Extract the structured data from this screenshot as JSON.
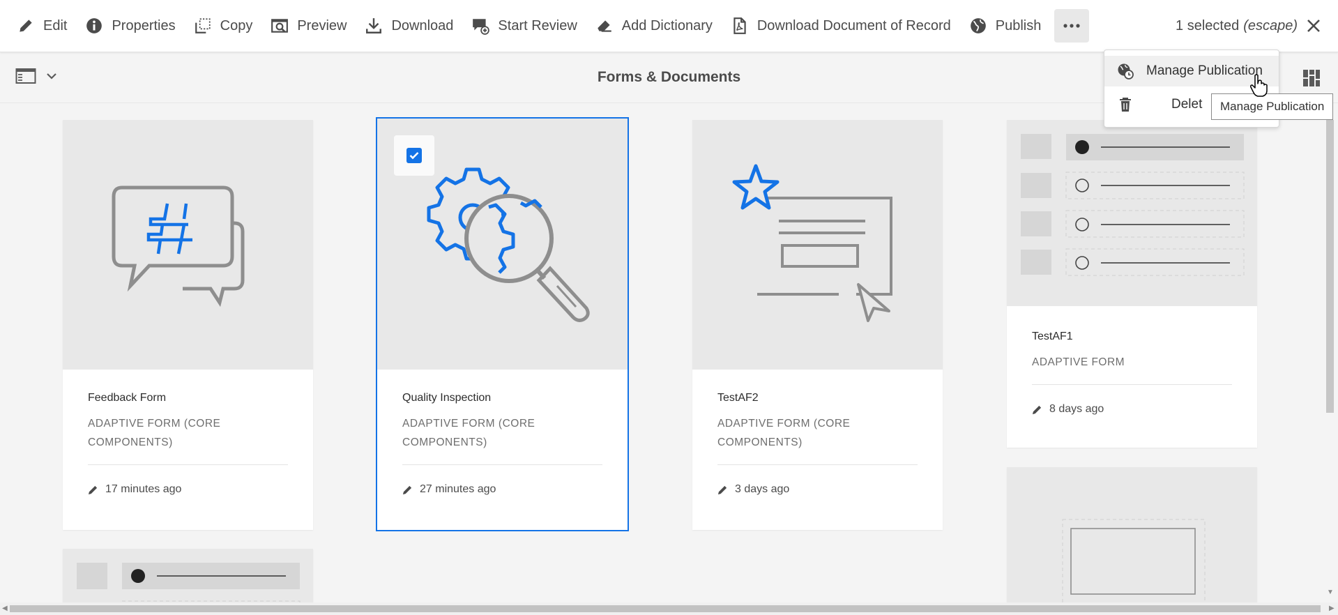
{
  "toolbar": {
    "actions": [
      {
        "label": "Edit",
        "icon": "pencil-icon"
      },
      {
        "label": "Properties",
        "icon": "info-icon"
      },
      {
        "label": "Copy",
        "icon": "copy-icon"
      },
      {
        "label": "Preview",
        "icon": "preview-icon"
      },
      {
        "label": "Download",
        "icon": "download-icon"
      },
      {
        "label": "Start Review",
        "icon": "review-icon"
      },
      {
        "label": "Add Dictionary",
        "icon": "eraser-icon"
      },
      {
        "label": "Download Document of Record",
        "icon": "pdf-icon"
      },
      {
        "label": "Publish",
        "icon": "globe-icon"
      }
    ],
    "more_icon": "more-icon",
    "selection_count": "1 selected",
    "selection_hint": "(escape)"
  },
  "header": {
    "title": "Forms & Documents"
  },
  "menu": {
    "items": [
      {
        "label": "Manage Publication",
        "icon": "globe-clock-icon"
      },
      {
        "label": "Delet",
        "icon": "trash-icon"
      }
    ],
    "tooltip": "Manage Publication"
  },
  "cards": [
    {
      "title": "Feedback Form",
      "type": "ADAPTIVE FORM (CORE COMPONENTS)",
      "modified": "17 minutes ago",
      "selected": false
    },
    {
      "title": "Quality Inspection",
      "type": "ADAPTIVE FORM (CORE COMPONENTS)",
      "modified": "27 minutes ago",
      "selected": true
    },
    {
      "title": "TestAF2",
      "type": "ADAPTIVE FORM (CORE COMPONENTS)",
      "modified": "3 days ago",
      "selected": false
    },
    {
      "title": "TestAF1",
      "type": "ADAPTIVE FORM",
      "modified": "8 days ago",
      "selected": false
    }
  ],
  "colors": {
    "accent": "#1473e6",
    "icon_gray": "#8e8e8e"
  }
}
